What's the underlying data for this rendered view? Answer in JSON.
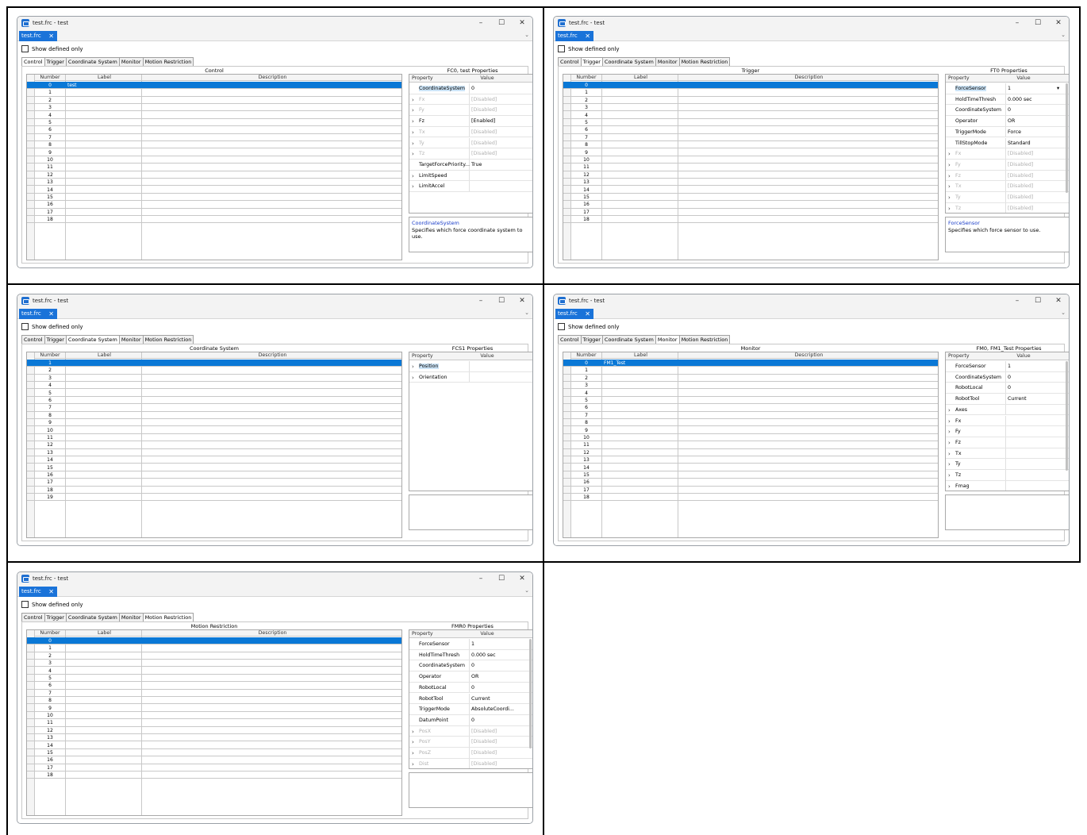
{
  "window": {
    "title": "test.frc - test",
    "file_tab": "test.frc",
    "minimize_icon": "–",
    "maximize_icon": "☐",
    "close_icon": "✕",
    "tab_close_icon": "✕",
    "chevron_icon": "⌄",
    "show_defined_label": "Show defined only",
    "tabs": [
      "Control",
      "Trigger",
      "Coordinate System",
      "Monitor",
      "Motion Restriction"
    ]
  },
  "grid_headers": {
    "number": "Number",
    "label": "Label",
    "description": "Description"
  },
  "prop_headers": {
    "property": "Property",
    "value": "Value"
  },
  "panels": [
    {
      "active_tab": 0,
      "grid_title": "Control",
      "numbers": [
        "0",
        "1",
        "2",
        "3",
        "4",
        "5",
        "6",
        "7",
        "8",
        "9",
        "10",
        "11",
        "12",
        "13",
        "14",
        "15",
        "16",
        "17",
        "18"
      ],
      "selected_index": 0,
      "labels": {
        "0": "test"
      },
      "prop_title": "FC0, test Properties",
      "props": [
        {
          "name": "CoordinateSystem",
          "value": "0",
          "exp": false,
          "dis": false,
          "sel": true
        },
        {
          "name": "Fx",
          "value": "[Disabled]",
          "exp": true,
          "dis": true
        },
        {
          "name": "Fy",
          "value": "[Disabled]",
          "exp": true,
          "dis": true
        },
        {
          "name": "Fz",
          "value": "[Enabled]",
          "exp": true,
          "dis": false
        },
        {
          "name": "Tx",
          "value": "[Disabled]",
          "exp": true,
          "dis": true
        },
        {
          "name": "Ty",
          "value": "[Disabled]",
          "exp": true,
          "dis": true
        },
        {
          "name": "Tz",
          "value": "[Disabled]",
          "exp": true,
          "dis": true
        },
        {
          "name": "TargetForcePriority...",
          "value": "True",
          "exp": false,
          "dis": false
        },
        {
          "name": "LimitSpeed",
          "value": "",
          "exp": true,
          "dis": false
        },
        {
          "name": "LimitAccel",
          "value": "",
          "exp": true,
          "dis": false
        }
      ],
      "desc_title": "CoordinateSystem",
      "desc_text": "Specifies which force coordinate system to use."
    },
    {
      "active_tab": 1,
      "grid_title": "Trigger",
      "numbers": [
        "0",
        "1",
        "2",
        "3",
        "4",
        "5",
        "6",
        "7",
        "8",
        "9",
        "10",
        "11",
        "12",
        "13",
        "14",
        "15",
        "16",
        "17",
        "18"
      ],
      "selected_index": 0,
      "labels": {},
      "prop_title": "FT0 Properties",
      "props": [
        {
          "name": "ForceSensor",
          "value": "1",
          "exp": false,
          "dis": false,
          "sel": true,
          "dropdown": true
        },
        {
          "name": "HoldTimeThresh",
          "value": "0.000 sec",
          "exp": false,
          "dis": false
        },
        {
          "name": "CoordinateSystem",
          "value": "0",
          "exp": false,
          "dis": false
        },
        {
          "name": "Operator",
          "value": "OR",
          "exp": false,
          "dis": false
        },
        {
          "name": "TriggerMode",
          "value": "Force",
          "exp": false,
          "dis": false
        },
        {
          "name": "TillStopMode",
          "value": "Standard",
          "exp": false,
          "dis": false
        },
        {
          "name": "Fx",
          "value": "[Disabled]",
          "exp": true,
          "dis": true
        },
        {
          "name": "Fy",
          "value": "[Disabled]",
          "exp": true,
          "dis": true
        },
        {
          "name": "Fz",
          "value": "[Disabled]",
          "exp": true,
          "dis": true
        },
        {
          "name": "Tx",
          "value": "[Disabled]",
          "exp": true,
          "dis": true
        },
        {
          "name": "Ty",
          "value": "[Disabled]",
          "exp": true,
          "dis": true
        },
        {
          "name": "Tz",
          "value": "[Disabled]",
          "exp": true,
          "dis": true
        }
      ],
      "desc_title": "ForceSensor",
      "desc_text": "Specifies which force sensor to use."
    },
    {
      "active_tab": 2,
      "grid_title": "Coordinate System",
      "numbers": [
        "1",
        "2",
        "3",
        "4",
        "5",
        "6",
        "7",
        "8",
        "9",
        "10",
        "11",
        "12",
        "13",
        "14",
        "15",
        "16",
        "17",
        "18",
        "19"
      ],
      "selected_index": 0,
      "labels": {},
      "prop_title": "FCS1 Properties",
      "props": [
        {
          "name": "Position",
          "value": "",
          "exp": true,
          "dis": false,
          "sel": true
        },
        {
          "name": "Orientation",
          "value": "",
          "exp": true,
          "dis": false
        }
      ],
      "desc_title": "",
      "desc_text": ""
    },
    {
      "active_tab": 3,
      "grid_title": "Monitor",
      "numbers": [
        "0",
        "1",
        "2",
        "3",
        "4",
        "5",
        "6",
        "7",
        "8",
        "9",
        "10",
        "11",
        "12",
        "13",
        "14",
        "15",
        "16",
        "17",
        "18"
      ],
      "selected_index": 0,
      "labels": {
        "0": "FM1_Test"
      },
      "prop_title": "FM0, FM1_Test Properties",
      "props": [
        {
          "name": "ForceSensor",
          "value": "1",
          "exp": false,
          "dis": false
        },
        {
          "name": "CoordinateSystem",
          "value": "0",
          "exp": false,
          "dis": false
        },
        {
          "name": "RobotLocal",
          "value": "0",
          "exp": false,
          "dis": false
        },
        {
          "name": "RobotTool",
          "value": "Current",
          "exp": false,
          "dis": false
        },
        {
          "name": "Axes",
          "value": "",
          "exp": true,
          "dis": false
        },
        {
          "name": "Fx",
          "value": "",
          "exp": true,
          "dis": false
        },
        {
          "name": "Fy",
          "value": "",
          "exp": true,
          "dis": false
        },
        {
          "name": "Fz",
          "value": "",
          "exp": true,
          "dis": false
        },
        {
          "name": "Tx",
          "value": "",
          "exp": true,
          "dis": false
        },
        {
          "name": "Ty",
          "value": "",
          "exp": true,
          "dis": false
        },
        {
          "name": "Tz",
          "value": "",
          "exp": true,
          "dis": false
        },
        {
          "name": "Fmag",
          "value": "",
          "exp": true,
          "dis": false
        }
      ],
      "desc_title": "",
      "desc_text": ""
    },
    {
      "active_tab": 4,
      "grid_title": "Motion Restriction",
      "numbers": [
        "0",
        "1",
        "2",
        "3",
        "4",
        "5",
        "6",
        "7",
        "8",
        "9",
        "10",
        "11",
        "12",
        "13",
        "14",
        "15",
        "16",
        "17",
        "18"
      ],
      "selected_index": 0,
      "labels": {},
      "prop_title": "FMR0 Properties",
      "props": [
        {
          "name": "ForceSensor",
          "value": "1",
          "exp": false,
          "dis": false
        },
        {
          "name": "HoldTimeThresh",
          "value": "0.000 sec",
          "exp": false,
          "dis": false
        },
        {
          "name": "CoordinateSystem",
          "value": "0",
          "exp": false,
          "dis": false
        },
        {
          "name": "Operator",
          "value": "OR",
          "exp": false,
          "dis": false
        },
        {
          "name": "RobotLocal",
          "value": "0",
          "exp": false,
          "dis": false
        },
        {
          "name": "RobotTool",
          "value": "Current",
          "exp": false,
          "dis": false
        },
        {
          "name": "TriggerMode",
          "value": "AbsoluteCoordi...",
          "exp": false,
          "dis": false
        },
        {
          "name": "DatumPoint",
          "value": "0",
          "exp": false,
          "dis": false
        },
        {
          "name": "PosX",
          "value": "[Disabled]",
          "exp": true,
          "dis": true
        },
        {
          "name": "PosY",
          "value": "[Disabled]",
          "exp": true,
          "dis": true
        },
        {
          "name": "PosZ",
          "value": "[Disabled]",
          "exp": true,
          "dis": true
        },
        {
          "name": "Dist",
          "value": "[Disabled]",
          "exp": true,
          "dis": true
        }
      ],
      "desc_title": "",
      "desc_text": ""
    }
  ]
}
